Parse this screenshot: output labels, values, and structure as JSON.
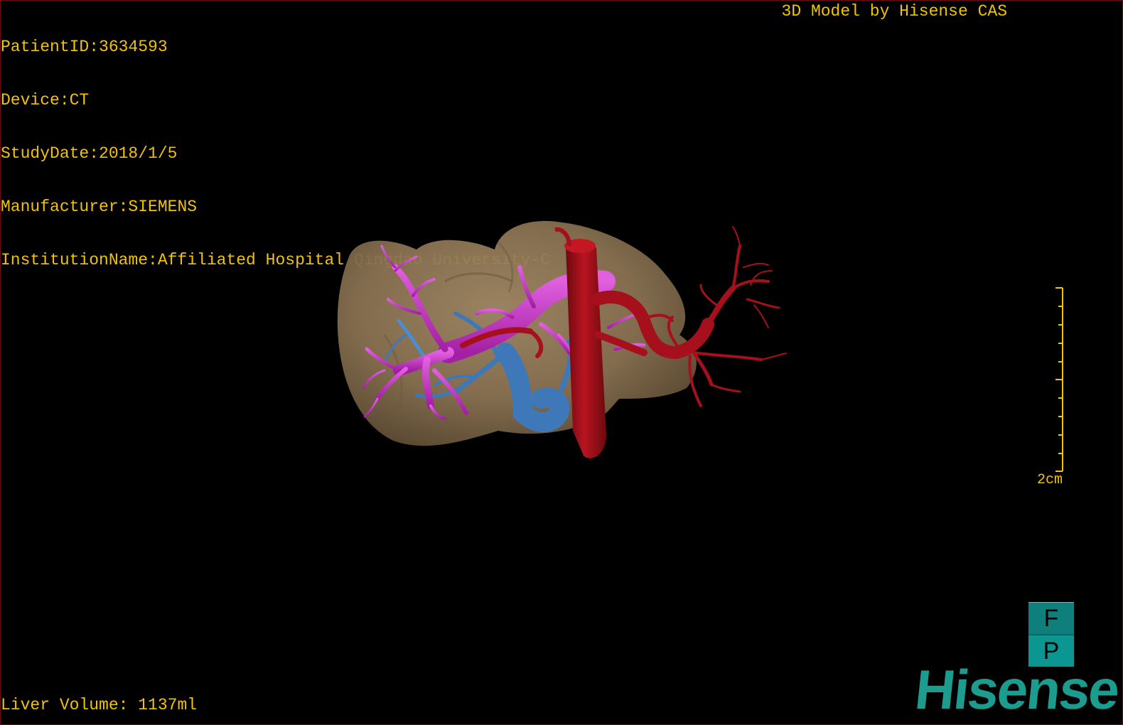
{
  "info": {
    "patient_id": "PatientID:3634593",
    "device": "Device:CT",
    "study_date": "StudyDate:2018/1/5",
    "manufacturer": "Manufacturer:SIEMENS",
    "institution": "InstitutionName:Affiliated Hospital Qingdao University-C"
  },
  "credit": "3D Model by Hisense CAS",
  "liver_volume": "Liver Volume: 1137ml",
  "scale": {
    "label": "2cm"
  },
  "orientation": {
    "top": "F",
    "bottom": "P"
  },
  "brand": "Hisense",
  "colors": {
    "text": "#f2c300",
    "liver": "#8c7452",
    "portal_vein": "#cc33cc",
    "hepatic_vein": "#3f78b8",
    "artery": "#a5101c",
    "brand": "#1c9b8f"
  }
}
